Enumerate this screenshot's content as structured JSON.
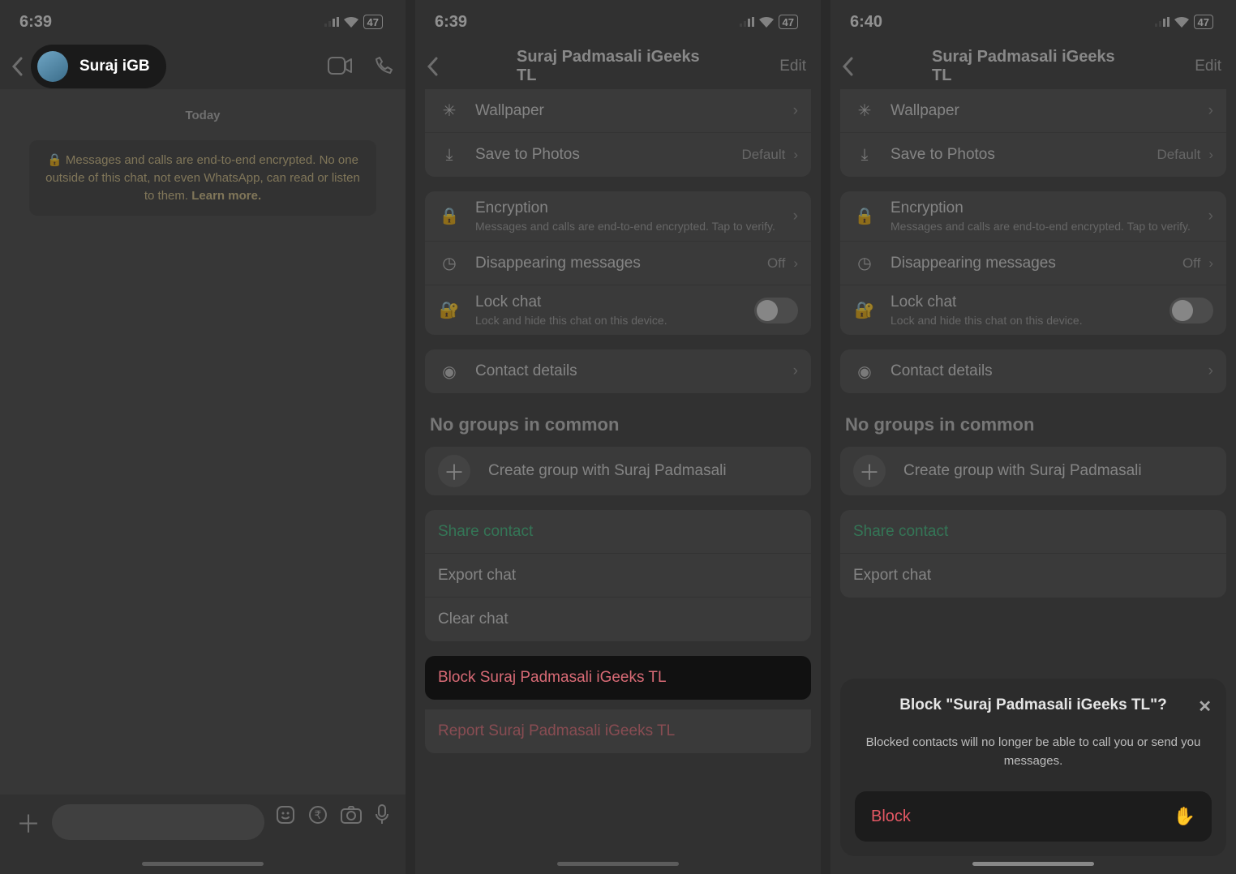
{
  "statusbar": {
    "time1": "6:39",
    "time2": "6:39",
    "time3": "6:40",
    "battery": "47"
  },
  "screen1": {
    "contact_name": "Suraj iGB",
    "today": "Today",
    "encrypt_text": "Messages and calls are end-to-end encrypted. No one outside of this chat, not even WhatsApp, can read or listen to them.",
    "learn_more": "Learn more."
  },
  "contact_info": {
    "title": "Suraj Padmasali iGeeks TL",
    "edit": "Edit",
    "wallpaper": "Wallpaper",
    "save_photos": "Save to Photos",
    "save_photos_value": "Default",
    "encryption": "Encryption",
    "encryption_sub": "Messages and calls are end-to-end encrypted. Tap to verify.",
    "disappearing": "Disappearing messages",
    "disappearing_value": "Off",
    "lock_chat": "Lock chat",
    "lock_chat_sub": "Lock and hide this chat on this device.",
    "contact_details": "Contact details",
    "no_groups": "No groups in common",
    "create_group": "Create group with Suraj Padmasali",
    "share_contact": "Share contact",
    "export_chat": "Export chat",
    "clear_chat": "Clear chat",
    "block": "Block Suraj Padmasali iGeeks TL",
    "report": "Report Suraj Padmasali iGeeks TL"
  },
  "sheet": {
    "title": "Block \"Suraj Padmasali iGeeks TL\"?",
    "message": "Blocked contacts will no longer be able to call you or send you messages.",
    "block_label": "Block"
  }
}
